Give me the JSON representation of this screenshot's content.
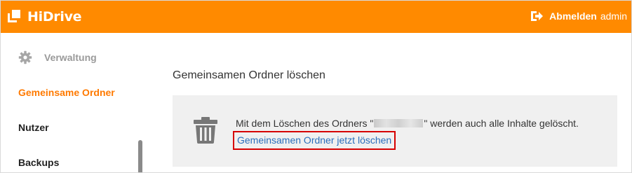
{
  "header": {
    "brand": "HiDrive",
    "logout_label": "Abmelden",
    "username": "admin",
    "background_color": "#ff8a00"
  },
  "sidebar": {
    "section": {
      "icon": "gear-icon",
      "label": "Verwaltung"
    },
    "items": [
      {
        "label": "Gemeinsame Ordner",
        "active": true
      },
      {
        "label": "Nutzer",
        "active": false
      },
      {
        "label": "Backups",
        "active": false
      }
    ],
    "accent_color": "#ff7a00"
  },
  "main": {
    "title": "Gemeinsamen Ordner löschen",
    "message_before": "Mit dem Löschen des Ordners \"",
    "message_after": "\" werden auch alle Inhalte gelöscht.",
    "delete_link": "Gemeinsamen Ordner jetzt löschen",
    "icon": "trash-icon",
    "link_color": "#2a6ebb",
    "highlight_color": "#d60000"
  }
}
